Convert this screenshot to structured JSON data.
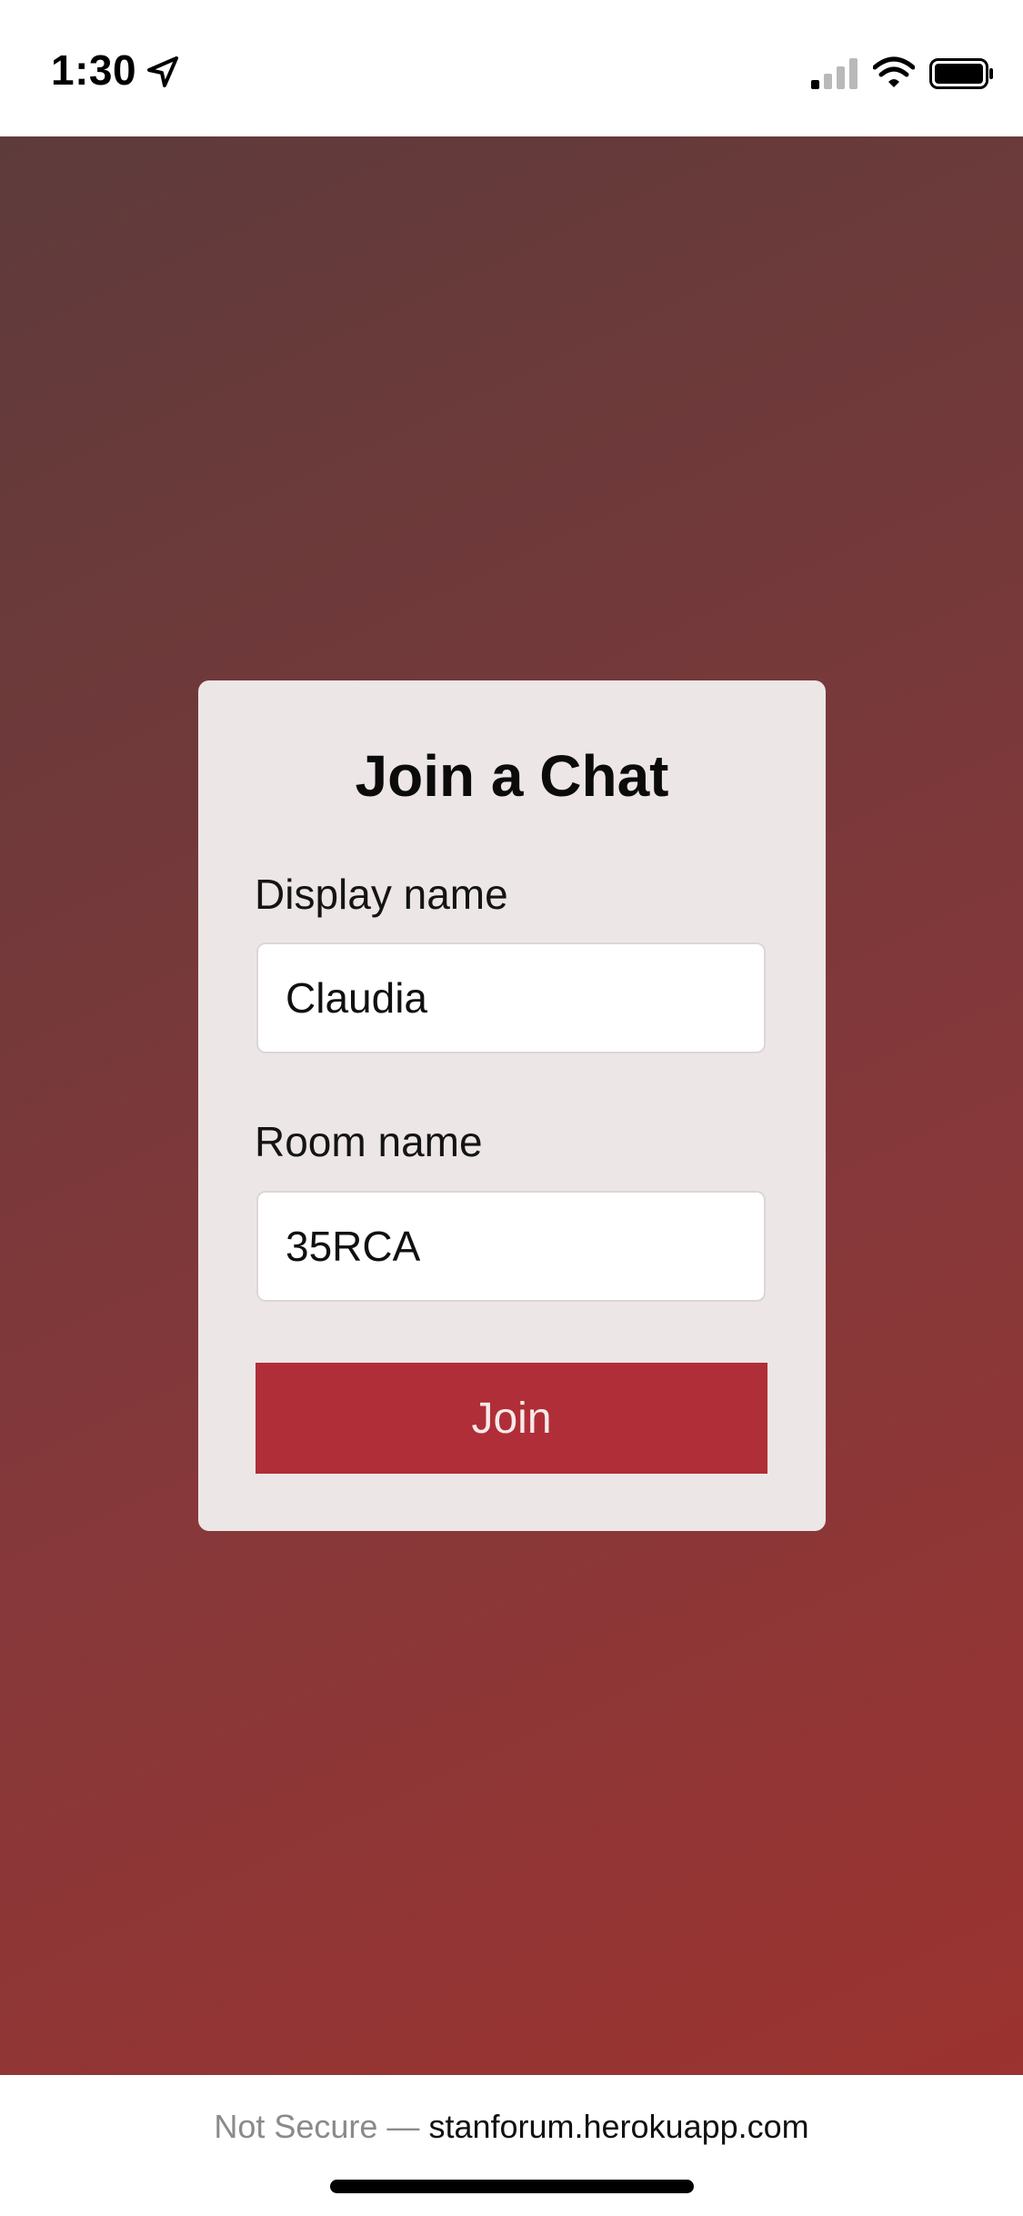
{
  "status_bar": {
    "time": "1:30",
    "icons": [
      "location-arrow-icon",
      "cellular-signal-icon",
      "wifi-icon",
      "battery-icon"
    ]
  },
  "card": {
    "title": "Join a Chat",
    "display_name_label": "Display name",
    "display_name_value": "Claudia",
    "room_name_label": "Room name",
    "room_name_value": "35RCA",
    "join_label": "Join"
  },
  "url_bar": {
    "security": "Not Secure —",
    "domain": "stanforum.herokuapp.com"
  },
  "colors": {
    "button": "#b02e37",
    "card": "#ede6e6",
    "background_start": "#5e3b3b",
    "background_end": "#9b3330"
  }
}
